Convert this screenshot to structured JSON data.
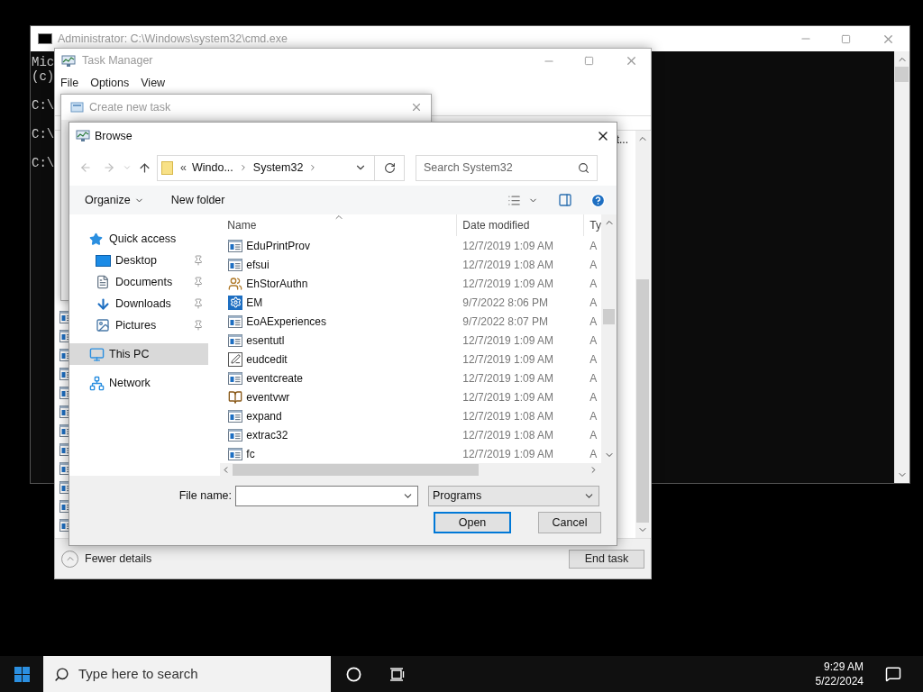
{
  "cmd_window": {
    "title": "Administrator: C:\\Windows\\system32\\cmd.exe",
    "blocks": [
      [
        "Mic",
        "(c)"
      ],
      [
        "C:\\"
      ],
      [
        "C:\\"
      ],
      [
        "C:\\"
      ]
    ]
  },
  "task_manager": {
    "title": "Task Manager",
    "menu": [
      "File",
      "Options",
      "View"
    ],
    "column_header": "t...",
    "fewer_details": "Fewer details",
    "end_task": "End task"
  },
  "create_task": {
    "title": "Create new task"
  },
  "browse": {
    "title": "Browse",
    "overflow": "«",
    "breadcrumb": [
      "Windo...",
      "System32"
    ],
    "search_placeholder": "Search System32",
    "toolbar": {
      "organize": "Organize",
      "new_folder": "New folder"
    },
    "nav": [
      {
        "label": "Quick access",
        "kind": "quick",
        "selected": false,
        "children": [
          {
            "label": "Desktop",
            "kind": "desktop",
            "pinned": true,
            "selected": false
          },
          {
            "label": "Documents",
            "kind": "documents",
            "pinned": true,
            "selected": false
          },
          {
            "label": "Downloads",
            "kind": "downloads",
            "pinned": true,
            "selected": false
          },
          {
            "label": "Pictures",
            "kind": "pictures",
            "pinned": true,
            "selected": false
          }
        ]
      },
      {
        "label": "This PC",
        "kind": "pc",
        "selected": true
      },
      {
        "label": "Network",
        "kind": "network",
        "selected": false
      }
    ],
    "columns": [
      "Name",
      "Date modified",
      "Ty"
    ],
    "files": [
      {
        "name": "EduPrintProv",
        "date": "12/7/2019 1:09 AM",
        "type": "A",
        "kind": "app"
      },
      {
        "name": "efsui",
        "date": "12/7/2019 1:08 AM",
        "type": "A",
        "kind": "app"
      },
      {
        "name": "EhStorAuthn",
        "date": "12/7/2019 1:09 AM",
        "type": "A",
        "kind": "people"
      },
      {
        "name": "EM",
        "date": "9/7/2022 8:06 PM",
        "type": "A",
        "kind": "gear"
      },
      {
        "name": "EoAExperiences",
        "date": "9/7/2022 8:07 PM",
        "type": "A",
        "kind": "app"
      },
      {
        "name": "esentutl",
        "date": "12/7/2019 1:09 AM",
        "type": "A",
        "kind": "app"
      },
      {
        "name": "eudcedit",
        "date": "12/7/2019 1:09 AM",
        "type": "A",
        "kind": "pen"
      },
      {
        "name": "eventcreate",
        "date": "12/7/2019 1:09 AM",
        "type": "A",
        "kind": "app"
      },
      {
        "name": "eventvwr",
        "date": "12/7/2019 1:09 AM",
        "type": "A",
        "kind": "log"
      },
      {
        "name": "expand",
        "date": "12/7/2019 1:08 AM",
        "type": "A",
        "kind": "app"
      },
      {
        "name": "extrac32",
        "date": "12/7/2019 1:08 AM",
        "type": "A",
        "kind": "app"
      },
      {
        "name": "fc",
        "date": "12/7/2019 1:09 AM",
        "type": "A",
        "kind": "app"
      }
    ],
    "file_name_label": "File name:",
    "file_type": "Programs",
    "buttons": [
      {
        "label": "Open",
        "default": true
      },
      {
        "label": "Cancel",
        "default": false
      }
    ]
  },
  "taskbar": {
    "search_placeholder": "Type here to search",
    "time": "9:29 AM",
    "date": "5/22/2024"
  }
}
